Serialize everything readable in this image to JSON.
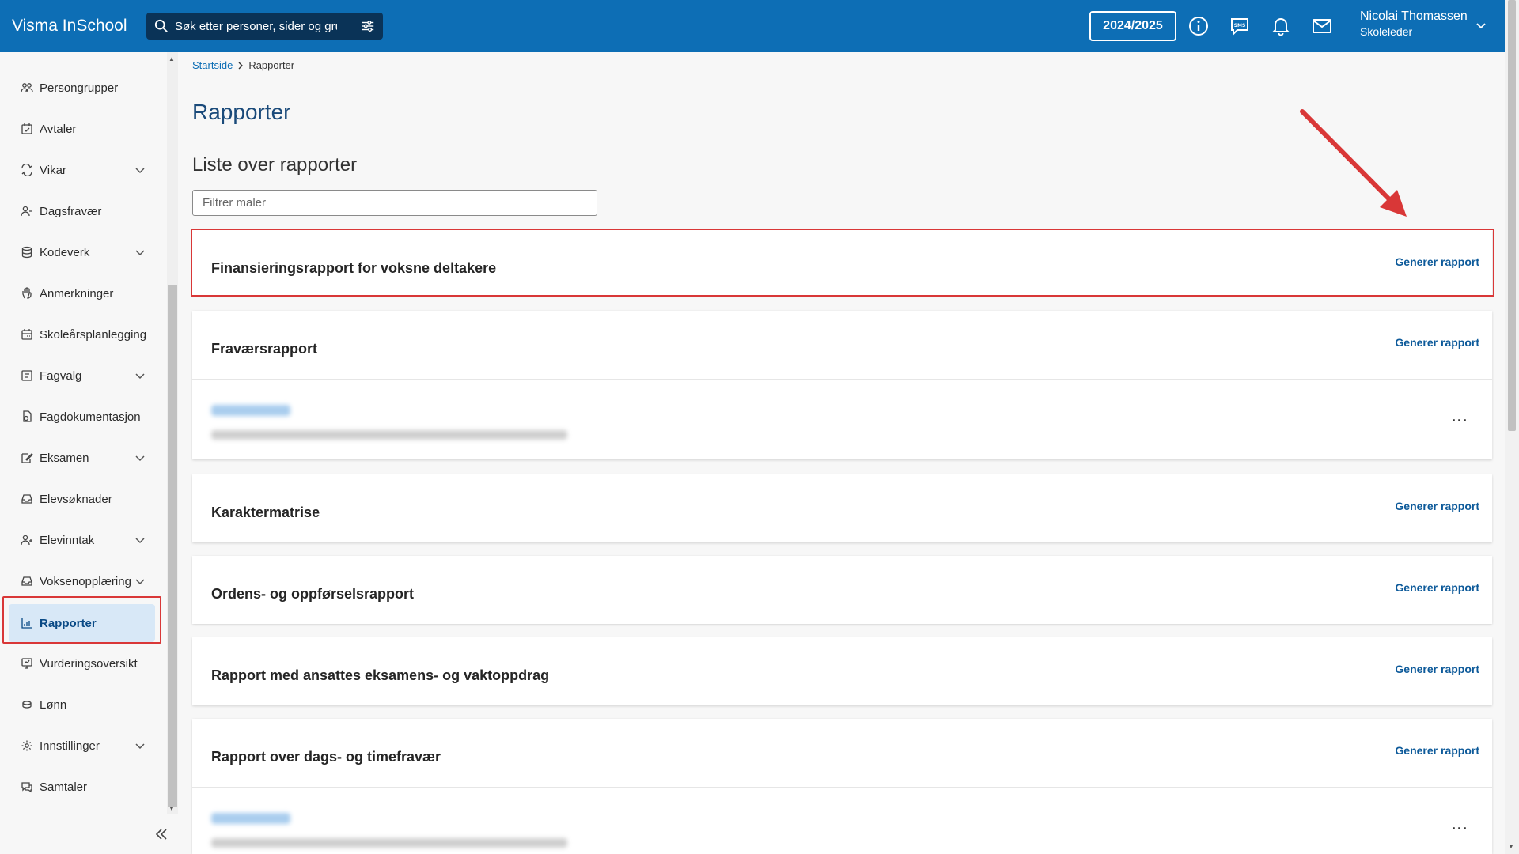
{
  "header": {
    "brand": "Visma InSchool",
    "search_placeholder": "Søk etter personer, sider og grupper",
    "school_year": "2024/2025",
    "user_name": "Nicolai Thomassen",
    "user_role": "Skoleleder"
  },
  "sidebar": {
    "items": [
      {
        "label": "Persongrupper",
        "icon": "people-icon",
        "chevron": false
      },
      {
        "label": "Avtaler",
        "icon": "calendar-check-icon",
        "chevron": false
      },
      {
        "label": "Vikar",
        "icon": "swap-icon",
        "chevron": true
      },
      {
        "label": "Dagsfravær",
        "icon": "person-minus-icon",
        "chevron": false
      },
      {
        "label": "Kodeverk",
        "icon": "database-icon",
        "chevron": true
      },
      {
        "label": "Anmerkninger",
        "icon": "hand-icon",
        "chevron": false
      },
      {
        "label": "Skoleårsplanlegging",
        "icon": "calendar-icon",
        "chevron": false
      },
      {
        "label": "Fagvalg",
        "icon": "checklist-icon",
        "chevron": true
      },
      {
        "label": "Fagdokumentasjon",
        "icon": "document-gear-icon",
        "chevron": false
      },
      {
        "label": "Eksamen",
        "icon": "edit-icon",
        "chevron": true
      },
      {
        "label": "Elevsøknader",
        "icon": "inbox-icon",
        "chevron": false
      },
      {
        "label": "Elevinntak",
        "icon": "person-add-icon",
        "chevron": true
      },
      {
        "label": "Voksenopplæring",
        "icon": "inbox-icon",
        "chevron": true
      },
      {
        "label": "Rapporter",
        "icon": "bar-chart-icon",
        "chevron": false,
        "active": true
      },
      {
        "label": "Vurderingsoversikt",
        "icon": "monitor-icon",
        "chevron": false
      },
      {
        "label": "Lønn",
        "icon": "coins-icon",
        "chevron": false
      },
      {
        "label": "Innstillinger",
        "icon": "gear-icon",
        "chevron": true
      },
      {
        "label": "Samtaler",
        "icon": "chat-icon",
        "chevron": false
      }
    ]
  },
  "breadcrumb": {
    "home": "Startside",
    "current": "Rapporter"
  },
  "main": {
    "title": "Rapporter",
    "section_title": "Liste over rapporter",
    "filter_placeholder": "Filtrer maler",
    "generate_label": "Generer rapport",
    "reports": [
      {
        "title": "Finansieringsrapport for voksne deltakere"
      },
      {
        "title": "Fraværsrapport"
      },
      {
        "title": "Karaktermatrise"
      },
      {
        "title": "Ordens- og oppførselsrapport"
      },
      {
        "title": "Rapport med ansattes eksamens- og vaktoppdrag"
      },
      {
        "title": "Rapport over dags- og timefravær"
      }
    ]
  },
  "colors": {
    "header_bg": "#0d6eb5",
    "accent": "#0d5a9a",
    "highlight": "#d93737",
    "active_bg": "#d8e8f7"
  }
}
